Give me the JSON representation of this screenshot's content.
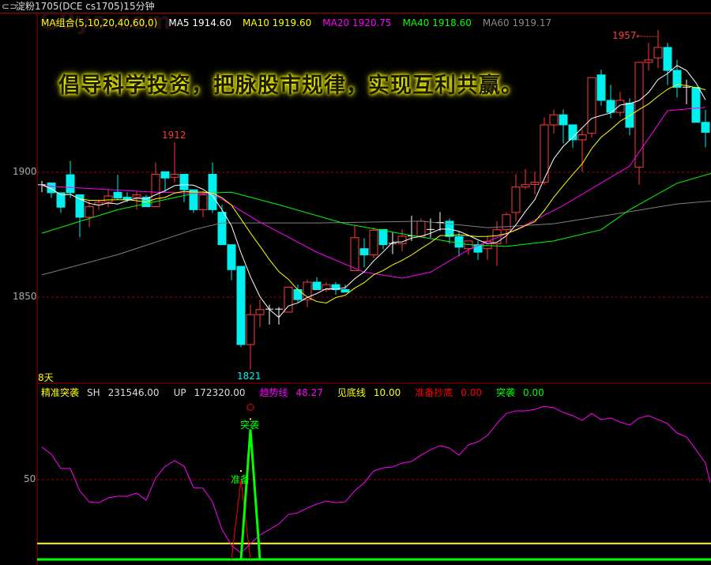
{
  "window": {
    "title": "淀粉1705(DCE cs1705)15分钟",
    "icon": "link-icon"
  },
  "watermark": "G0yo.com",
  "ma_legend": {
    "combo": "MA组合(5,10,20,40,60,0)",
    "ma5": "MA5 1914.60",
    "ma10": "MA10 1919.60",
    "ma20": "MA20 1920.75",
    "ma40": "MA40 1918.60",
    "ma60": "MA60 1919.17"
  },
  "slogan": "倡导科学投资，把脉股市规律，实现互利共赢。",
  "axis": {
    "p1900": "1900",
    "p1850": "1850",
    "ind50": "50"
  },
  "markers": {
    "high_local": "1912",
    "low": "1821",
    "high": "1957",
    "high_arrow": "←-----",
    "days": "8天"
  },
  "indicator_legend": {
    "name": "精准突袭",
    "sh_label": "SH",
    "sh": "231546.00",
    "up_label": "UP",
    "up": "172320.00",
    "trend_label": "趋势线",
    "trend": "48.27",
    "bottom_label": "见底线",
    "bottom": "10.00",
    "ready_label": "准备抄底",
    "ready": "0.00",
    "raid_label": "突袭",
    "raid": "0.00"
  },
  "indicator_marks": {
    "raid": "突袭",
    "ready": "准备"
  },
  "colors": {
    "up": "#ff3c3c",
    "down": "#00f0f0",
    "ma5": "#ffffff",
    "ma10": "#ffff00",
    "ma20": "#ff00ff",
    "ma40": "#00ff00",
    "ma60": "#808080",
    "grid": "#a00000"
  },
  "chart_data": {
    "type": "candlestick",
    "price_range": [
      1815,
      1960
    ],
    "gridlines": [
      1900,
      1850
    ],
    "candles": [
      [
        1895,
        1895,
        1896.5,
        1892
      ],
      [
        1895.7,
        1891.8,
        1895.7,
        1889.7
      ],
      [
        1891.8,
        1886,
        1891.8,
        1883.7
      ],
      [
        1899,
        1891.8,
        1904.6,
        1889.7
      ],
      [
        1891,
        1882,
        1891,
        1874
      ],
      [
        1882,
        1886.2,
        1889,
        1878
      ],
      [
        1887,
        1888,
        1889,
        1885
      ],
      [
        1888,
        1890.5,
        1893,
        1886
      ],
      [
        1892,
        1889.7,
        1899,
        1889
      ],
      [
        1890,
        1889,
        1892,
        1888
      ],
      [
        1889.9,
        1891,
        1892.2,
        1885
      ],
      [
        1890,
        1886.2,
        1891,
        1886.2
      ],
      [
        1886.2,
        1899.2,
        1903.9,
        1886.2
      ],
      [
        1900.2,
        1897.7,
        1900.2,
        1891.8
      ],
      [
        1898,
        1899.2,
        1912,
        1896
      ],
      [
        1899.2,
        1893,
        1899.2,
        1888
      ],
      [
        1893,
        1885,
        1893,
        1883.7
      ],
      [
        1885,
        1891,
        1892.5,
        1882
      ],
      [
        1899.2,
        1885,
        1903.9,
        1883.7
      ],
      [
        1884,
        1871,
        1887,
        1871
      ],
      [
        1871,
        1861,
        1871,
        1856.8
      ],
      [
        1862.3,
        1831,
        1862.3,
        1830
      ],
      [
        1831,
        1843,
        1847,
        1821
      ],
      [
        1843,
        1845,
        1849,
        1838
      ],
      [
        1845,
        1845.2,
        1847,
        1839
      ],
      [
        1845,
        1845.2,
        1846,
        1839
      ],
      [
        1844,
        1854,
        1854,
        1844
      ],
      [
        1853,
        1849,
        1855,
        1848
      ],
      [
        1849,
        1856,
        1857,
        1846
      ],
      [
        1856,
        1853,
        1858,
        1853
      ],
      [
        1853,
        1855,
        1856,
        1852
      ],
      [
        1855,
        1853,
        1856,
        1851
      ],
      [
        1853,
        1852,
        1855,
        1852
      ],
      [
        1860.6,
        1873.8,
        1878.9,
        1860.6
      ],
      [
        1869.4,
        1866.9,
        1873.6,
        1862
      ],
      [
        1866.9,
        1876.8,
        1877.9,
        1865.6
      ],
      [
        1877.1,
        1871,
        1877.1,
        1869.2
      ],
      [
        1871.4,
        1871.5,
        1876.1,
        1867.2
      ],
      [
        1871.4,
        1874.4,
        1877.1,
        1868.3
      ],
      [
        1874.4,
        1874.5,
        1882.6,
        1872.5
      ],
      [
        1874.4,
        1880.4,
        1881.5,
        1874.4
      ],
      [
        1877,
        1877.1,
        1881.5,
        1873.8
      ],
      [
        1879.8,
        1879.9,
        1884.1,
        1876.5
      ],
      [
        1880.4,
        1874.3,
        1881.5,
        1871.4
      ],
      [
        1874.3,
        1870,
        1876.2,
        1866.3
      ],
      [
        1869.4,
        1872.5,
        1872.5,
        1866.8
      ],
      [
        1871,
        1868,
        1872.5,
        1864.9
      ],
      [
        1869.4,
        1872.3,
        1874.6,
        1864.9
      ],
      [
        1871.4,
        1877,
        1880.4,
        1862.5
      ],
      [
        1877,
        1883,
        1883.9,
        1871.4
      ],
      [
        1883.9,
        1894.1,
        1899.2,
        1880.4
      ],
      [
        1894.1,
        1895,
        1901.3,
        1893.2
      ],
      [
        1895.1,
        1896,
        1900.2,
        1891.1
      ],
      [
        1896,
        1919,
        1921.9,
        1895
      ],
      [
        1919,
        1923,
        1925.1,
        1915.5
      ],
      [
        1923,
        1919,
        1925.1,
        1911.5
      ],
      [
        1919,
        1913,
        1919.2,
        1909.8
      ],
      [
        1913,
        1915,
        1917.2,
        1900.2
      ],
      [
        1915.6,
        1937.9,
        1938.1,
        1913.9
      ],
      [
        1939,
        1928.8,
        1941.1,
        1926.7
      ],
      [
        1928.8,
        1924,
        1935,
        1921.7
      ],
      [
        1924,
        1928.8,
        1932.2,
        1922.3
      ],
      [
        1927.7,
        1918,
        1929.6,
        1914.8
      ],
      [
        1902,
        1944,
        1944.2,
        1895
      ],
      [
        1944,
        1945,
        1951.8,
        1940.7
      ],
      [
        1945.8,
        1950,
        1957,
        1941.8
      ],
      [
        1950,
        1940.8,
        1951.8,
        1935
      ],
      [
        1940.8,
        1934,
        1945,
        1930
      ],
      [
        1934,
        1934.1,
        1937.1,
        1927.2
      ],
      [
        1934,
        1920,
        1934,
        1920
      ],
      [
        1920,
        1916,
        1925,
        1910
      ]
    ],
    "ma20": [
      [
        0,
        1894.6
      ],
      [
        12,
        1892
      ],
      [
        18,
        1891.5
      ],
      [
        23,
        1880
      ],
      [
        29,
        1868
      ],
      [
        34,
        1860
      ],
      [
        38,
        1857.6
      ],
      [
        41,
        1860
      ],
      [
        45,
        1869
      ],
      [
        50,
        1877
      ],
      [
        55,
        1886.7
      ],
      [
        62,
        1902.5
      ],
      [
        66,
        1924.7
      ],
      [
        70,
        1926
      ]
    ],
    "ma40": [
      [
        0,
        1875.6
      ],
      [
        8,
        1885
      ],
      [
        16,
        1891.5
      ],
      [
        20,
        1892
      ],
      [
        25,
        1887
      ],
      [
        32,
        1879.4
      ],
      [
        39,
        1874.7
      ],
      [
        45,
        1871
      ],
      [
        49,
        1870.3
      ],
      [
        54,
        1872.5
      ],
      [
        59,
        1877
      ],
      [
        62,
        1885
      ],
      [
        67,
        1895.6
      ],
      [
        71,
        1900
      ]
    ],
    "ma60": [
      [
        0,
        1858.9
      ],
      [
        8,
        1867
      ],
      [
        16,
        1877
      ],
      [
        19,
        1879.7
      ],
      [
        29,
        1879.7
      ],
      [
        40,
        1880.4
      ],
      [
        47,
        1877.8
      ],
      [
        54,
        1879.4
      ],
      [
        60,
        1883
      ],
      [
        67,
        1887.3
      ],
      [
        71,
        1888.6
      ]
    ],
    "indicator": {
      "range": [
        0,
        100
      ],
      "trend": [
        70.4,
        66,
        57,
        57,
        43,
        36,
        35.5,
        38.6,
        39.6,
        39.6,
        41.6,
        37.1,
        51,
        58.4,
        61.9,
        58.4,
        45,
        44.6,
        36.1,
        18.8,
        8.9,
        4,
        9.9,
        15.3,
        18.8,
        22.3,
        28.2,
        29.2,
        32.2,
        34.7,
        36.6,
        35.6,
        36.1,
        43,
        48,
        55.4,
        57.4,
        57.9,
        60.4,
        61.4,
        65.3,
        68.8,
        71.3,
        69.8,
        65.3,
        71.8,
        73.7,
        77.7,
        85.1,
        91.5,
        93.1,
        93.1,
        94,
        96,
        95,
        92.1,
        90.1,
        87.1,
        91.5,
        87.6,
        88.6,
        86.1,
        84.2,
        88.6,
        90.1,
        87.6,
        85.1,
        79.2,
        76.7,
        68.8,
        60.4,
        48.27
      ],
      "bottom_line": 10,
      "ready_spike": {
        "index": 21,
        "value": 50
      },
      "raid_spike": {
        "index": 22,
        "value": 81.5
      }
    }
  }
}
